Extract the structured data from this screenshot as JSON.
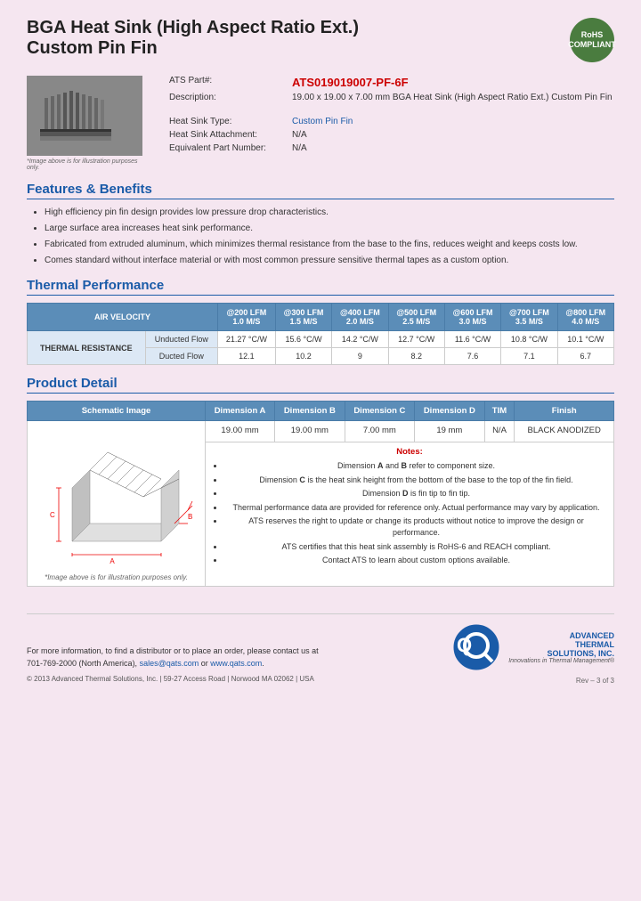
{
  "header": {
    "title_line1": "BGA Heat Sink (High Aspect Ratio Ext.)",
    "title_line2": "Custom Pin Fin",
    "rohs": "RoHS\nCOMPLIANT"
  },
  "specs": {
    "part_label": "ATS Part#:",
    "part_number": "ATS019019007-PF-6F",
    "desc_label": "Description:",
    "description": "19.00 x 19.00 x 7.00 mm BGA Heat Sink (High Aspect Ratio Ext.) Custom Pin Fin",
    "type_label": "Heat Sink Type:",
    "type_value": "Custom Pin Fin",
    "attachment_label": "Heat Sink Attachment:",
    "attachment_value": "N/A",
    "equiv_label": "Equivalent Part Number:",
    "equiv_value": "N/A"
  },
  "image_note": "*Image above is for illustration purposes only.",
  "features": {
    "title": "Features & Benefits",
    "items": [
      "High efficiency pin fin design provides low pressure drop characteristics.",
      "Large surface area increases heat sink performance.",
      "Fabricated from extruded aluminum, which minimizes thermal resistance from the base to the fins, reduces weight and keeps costs low.",
      "Comes standard without interface material or with most common pressure sensitive thermal tapes as a custom option."
    ]
  },
  "thermal": {
    "title": "Thermal Performance",
    "col_header_0": "AIR VELOCITY",
    "columns": [
      "@200 LFM\n1.0 M/S",
      "@300 LFM\n1.5 M/S",
      "@400 LFM\n2.0 M/S",
      "@500 LFM\n2.5 M/S",
      "@600 LFM\n3.0 M/S",
      "@700 LFM\n3.5 M/S",
      "@800 LFM\n4.0 M/S"
    ],
    "row_label": "THERMAL RESISTANCE",
    "rows": [
      {
        "label": "Unducted Flow",
        "values": [
          "21.27 °C/W",
          "15.6 °C/W",
          "14.2 °C/W",
          "12.7 °C/W",
          "11.6 °C/W",
          "10.8 °C/W",
          "10.1 °C/W"
        ]
      },
      {
        "label": "Ducted Flow",
        "values": [
          "12.1",
          "10.2",
          "9",
          "8.2",
          "7.6",
          "7.1",
          "6.7"
        ]
      }
    ]
  },
  "product_detail": {
    "title": "Product Detail",
    "columns": [
      "Schematic Image",
      "Dimension A",
      "Dimension B",
      "Dimension C",
      "Dimension D",
      "TIM",
      "Finish"
    ],
    "dim_values": [
      "19.00 mm",
      "19.00 mm",
      "7.00 mm",
      "19 mm",
      "N/A",
      "BLACK ANODIZED"
    ],
    "notes_title": "Notes:",
    "notes": [
      "Dimension A and B refer to component size.",
      "Dimension C is the heat sink height from the bottom of the base to the top of the fin field.",
      "Dimension D is fin tip to fin tip.",
      "Thermal performance data are provided for reference only. Actual performance may vary by application.",
      "ATS reserves the right to update or change its products without notice to improve the design or performance.",
      "ATS certifies that this heat sink assembly is RoHS-6 and REACH compliant.",
      "Contact ATS to learn about custom options available."
    ],
    "schematic_note": "*Image above is for illustration purposes only."
  },
  "footer": {
    "contact_text": "For more information, to find a distributor or to place an order, please contact us at\n701-769-2000 (North America),",
    "email": "sales@qats.com",
    "or_text": " or ",
    "website": "www.qats.com",
    "copyright": "© 2013 Advanced Thermal Solutions, Inc. | 59-27 Access Road | Norwood MA  02062 | USA",
    "ats_advanced": "ADVANCED",
    "ats_thermal": "THERMAL",
    "ats_solutions": "SOLUTIONS, INC.",
    "tagline": "Innovations in Thermal Management®",
    "page_number": "Rev – 3 of 3"
  }
}
